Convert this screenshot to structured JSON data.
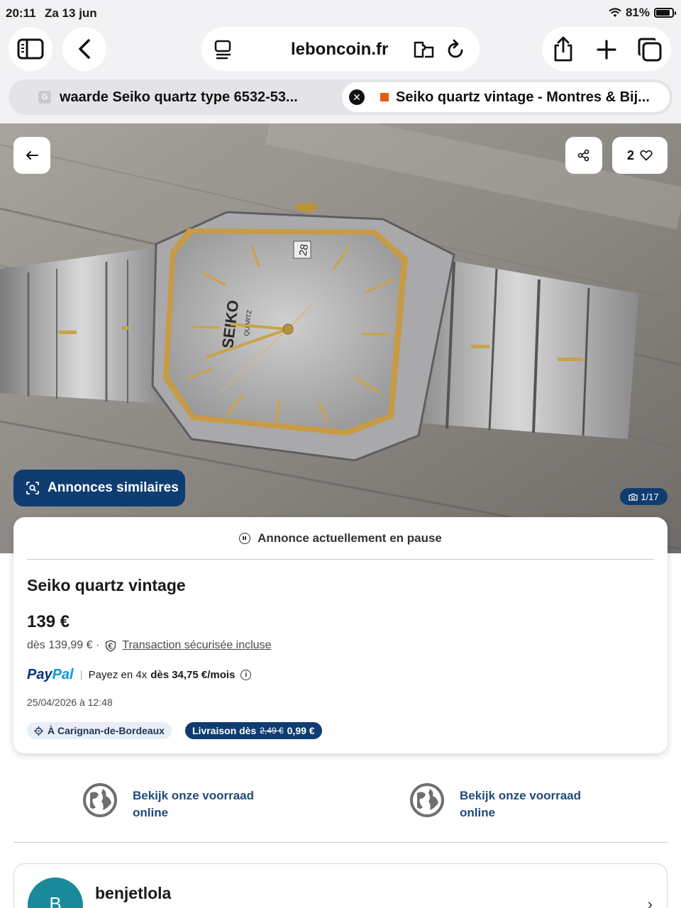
{
  "status_bar": {
    "time": "20:11",
    "date": "Za 13 jun",
    "battery": "81%"
  },
  "browser": {
    "url": "leboncoin.fr",
    "tabs": [
      {
        "title": "waarde Seiko quartz type 6532-53...",
        "favicon": "G"
      },
      {
        "title": "Seiko quartz vintage - Montres & Bij...",
        "active": true
      }
    ]
  },
  "gallery": {
    "like_count": "2",
    "similar_label": "Annonces similaires",
    "photo_index": "1/17"
  },
  "listing": {
    "status": "Annonce actuellement en pause",
    "title": "Seiko quartz vintage",
    "price": "139 €",
    "from_price": "dès 139,99 € ·",
    "secure_label": "Transaction sécurisée incluse",
    "paypal": {
      "logo_a": "Pay",
      "logo_b": "Pal",
      "text": "Payez en 4x",
      "amount": "dès 34,75 €/mois"
    },
    "date": "25/04/2026 à 12:48",
    "location": "À Carignan-de-Bordeaux",
    "shipping": {
      "label": "Livraison dès",
      "old_price": "2,49 €",
      "new_price": "0,99 €"
    }
  },
  "promos": [
    {
      "text": "Bekijk onze voorraad online"
    },
    {
      "text": "Bekijk onze voorraad online"
    }
  ],
  "seller": {
    "initial": "B",
    "name": "benjetlola"
  },
  "colors": {
    "brand_navy": "#0f3d72",
    "paypal_dark": "#003087",
    "paypal_light": "#009cde",
    "link_blue": "#1f4a7a"
  }
}
